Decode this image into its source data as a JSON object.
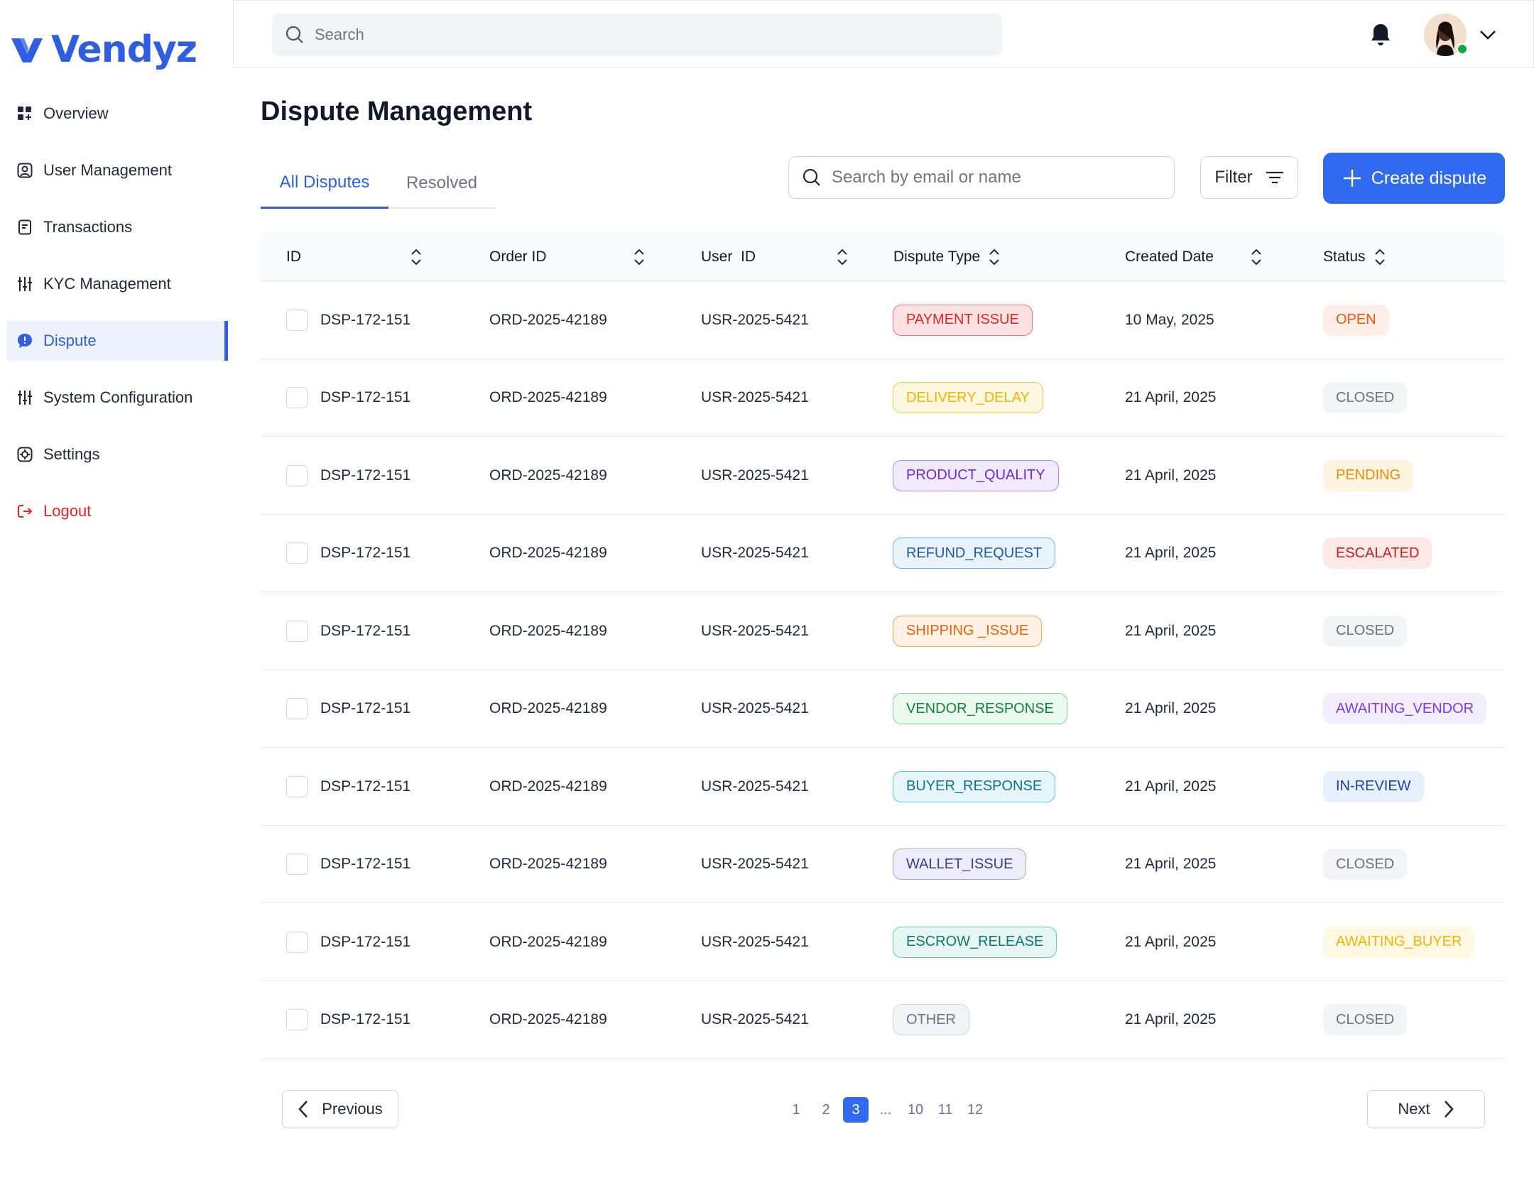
{
  "brand": {
    "name": "Vendyz",
    "accent": "#2f5fe0"
  },
  "sidebar": {
    "items": [
      {
        "label": "Overview",
        "icon": "grid-icon"
      },
      {
        "label": "User Management",
        "icon": "user-square-icon"
      },
      {
        "label": "Transactions",
        "icon": "receipt-icon"
      },
      {
        "label": "KYC Management",
        "icon": "sliders-icon"
      },
      {
        "label": "Dispute",
        "icon": "chat-alert-icon",
        "active": true
      },
      {
        "label": "System Configuration",
        "icon": "sliders-icon"
      },
      {
        "label": "Settings",
        "icon": "settings-icon"
      },
      {
        "label": "Logout",
        "icon": "logout-icon"
      }
    ]
  },
  "topbar": {
    "search_placeholder": "Search"
  },
  "page": {
    "title": "Dispute Management",
    "tabs": [
      "All Disputes",
      "Resolved"
    ],
    "search_placeholder": "Search by email or name",
    "filter_label": "Filter",
    "create_label": "Create dispute"
  },
  "table": {
    "columns": [
      "ID",
      "Order ID",
      "User  ID",
      "Dispute Type",
      "Created Date",
      "Status"
    ],
    "rows": [
      {
        "id": "DSP-172-151",
        "order": "ORD-2025-42189",
        "user": "USR-2025-5421",
        "type": "PAYMENT ISSUE",
        "date": "10 May, 2025",
        "status": "OPEN"
      },
      {
        "id": "DSP-172-151",
        "order": "ORD-2025-42189",
        "user": "USR-2025-5421",
        "type": "DELIVERY_DELAY",
        "date": "21 April, 2025",
        "status": "CLOSED"
      },
      {
        "id": "DSP-172-151",
        "order": "ORD-2025-42189",
        "user": "USR-2025-5421",
        "type": "PRODUCT_QUALITY",
        "date": "21 April, 2025",
        "status": "PENDING"
      },
      {
        "id": "DSP-172-151",
        "order": "ORD-2025-42189",
        "user": "USR-2025-5421",
        "type": "REFUND_REQUEST",
        "date": "21 April, 2025",
        "status": "ESCALATED"
      },
      {
        "id": "DSP-172-151",
        "order": "ORD-2025-42189",
        "user": "USR-2025-5421",
        "type": "SHIPPING _ISSUE",
        "date": "21 April, 2025",
        "status": "CLOSED"
      },
      {
        "id": "DSP-172-151",
        "order": "ORD-2025-42189",
        "user": "USR-2025-5421",
        "type": "VENDOR_RESPONSE",
        "date": "21 April, 2025",
        "status": "AWAITING_VENDOR"
      },
      {
        "id": "DSP-172-151",
        "order": "ORD-2025-42189",
        "user": "USR-2025-5421",
        "type": "BUYER_RESPONSE",
        "date": "21 April, 2025",
        "status": "IN-REVIEW"
      },
      {
        "id": "DSP-172-151",
        "order": "ORD-2025-42189",
        "user": "USR-2025-5421",
        "type": "WALLET_ISSUE",
        "date": "21 April, 2025",
        "status": "CLOSED"
      },
      {
        "id": "DSP-172-151",
        "order": "ORD-2025-42189",
        "user": "USR-2025-5421",
        "type": "ESCROW_RELEASE",
        "date": "21 April, 2025",
        "status": "AWAITING_BUYER"
      },
      {
        "id": "DSP-172-151",
        "order": "ORD-2025-42189",
        "user": "USR-2025-5421",
        "type": "OTHER",
        "date": "21 April, 2025",
        "status": "CLOSED"
      }
    ]
  },
  "type_colors": {
    "PAYMENT ISSUE": {
      "fg": "#dc2626",
      "bg": "#fee2e2",
      "border": "#f87171"
    },
    "DELIVERY_DELAY": {
      "fg": "#f5b400",
      "bg": "#fff7e0",
      "border": "#f9c74f"
    },
    "PRODUCT_QUALITY": {
      "fg": "#6d28d9",
      "bg": "#f1eafe",
      "border": "#a78bfa"
    },
    "REFUND_REQUEST": {
      "fg": "#1e5aa8",
      "bg": "#e8f3fc",
      "border": "#6cb4e6"
    },
    "SHIPPING _ISSUE": {
      "fg": "#e36414",
      "bg": "#fff1e3",
      "border": "#f6a55a"
    },
    "VENDOR_RESPONSE": {
      "fg": "#15803d",
      "bg": "#ecfbef",
      "border": "#7ed491"
    },
    "BUYER_RESPONSE": {
      "fg": "#0e7490",
      "bg": "#e6f6fb",
      "border": "#5fc3e2"
    },
    "WALLET_ISSUE": {
      "fg": "#3f3f8f",
      "bg": "#ececfa",
      "border": "#a5a8e0"
    },
    "ESCROW_RELEASE": {
      "fg": "#0f766e",
      "bg": "#e6f6f2",
      "border": "#6fc6b0"
    },
    "OTHER": {
      "fg": "#6b7280",
      "bg": "#f3f4f6",
      "border": "#d1d5db"
    }
  },
  "status_colors": {
    "OPEN": {
      "fg": "#e8590c",
      "bg": "#fdeee7"
    },
    "CLOSED": {
      "fg": "#6b7280",
      "bg": "#f3f4f6"
    },
    "PENDING": {
      "fg": "#f08c00",
      "bg": "#fff4e0"
    },
    "ESCALATED": {
      "fg": "#c81e1e",
      "bg": "#fde8e8"
    },
    "AWAITING_VENDOR": {
      "fg": "#7c3aed",
      "bg": "#f3eefe"
    },
    "IN-REVIEW": {
      "fg": "#1e40af",
      "bg": "#e7f1fd"
    },
    "AWAITING_BUYER": {
      "fg": "#f5b400",
      "bg": "#fff8e3"
    }
  },
  "pagination": {
    "prev_label": "Previous",
    "next_label": "Next",
    "pages": [
      "1",
      "2",
      "3",
      "...",
      "10",
      "11",
      "12"
    ],
    "current": "3"
  }
}
